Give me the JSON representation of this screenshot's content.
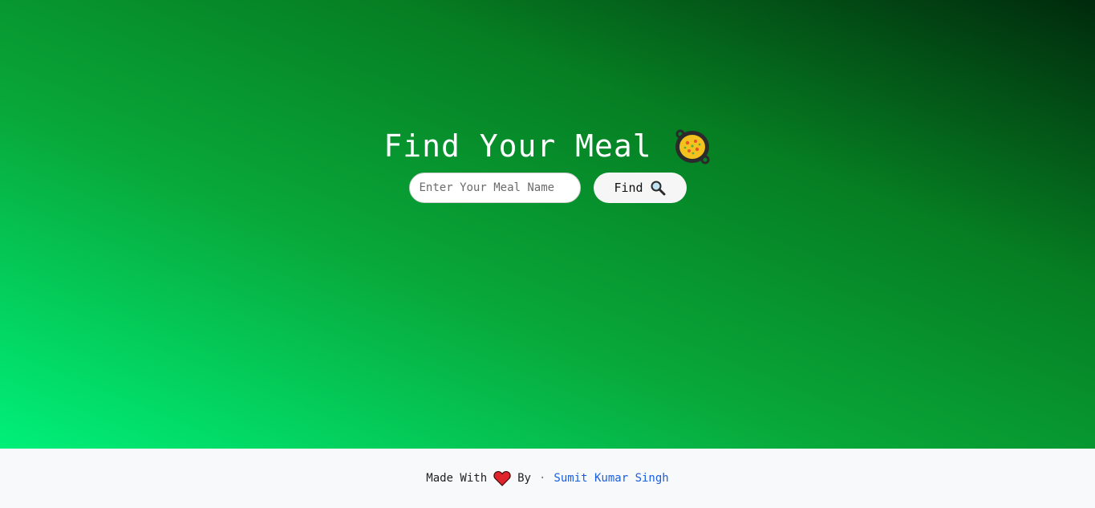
{
  "header": {
    "title": "Find Your Meal",
    "title_icon": "paella-pan-icon"
  },
  "search": {
    "placeholder": "Enter Your Meal Name",
    "value": "",
    "button_label": "Find",
    "button_icon": "magnifying-glass-icon"
  },
  "footer": {
    "made_with": "Made With",
    "heart_icon": "heart-icon",
    "by": "By",
    "separator": "·",
    "author": "Sumit Kumar Singh"
  },
  "colors": {
    "gradient_light": "#00f07a",
    "gradient_mid": "#08a83a",
    "gradient_dark": "#002a0c",
    "footer_bg": "#f8f9fa",
    "link": "#1a5fe0"
  }
}
